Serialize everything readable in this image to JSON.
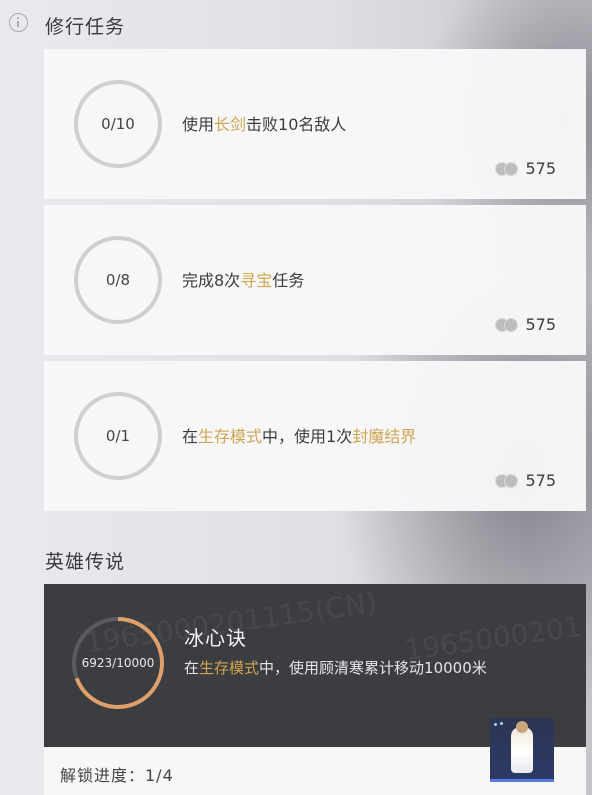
{
  "header": {
    "title": "修行任务"
  },
  "tasks": [
    {
      "progress": "0/10",
      "parts": [
        "使用",
        "长剑",
        "击败10名敌人"
      ],
      "reward": "575"
    },
    {
      "progress": "0/8",
      "parts": [
        "完成8次",
        "寻宝",
        "任务"
      ],
      "reward": "575"
    },
    {
      "progress": "0/1",
      "parts": [
        "在",
        "生存模式",
        "中，使用1次",
        "封魔结界"
      ],
      "reward": "575"
    }
  ],
  "legend": {
    "section_title": "英雄传说",
    "progress": "6923/10000",
    "progress_fraction": 0.6923,
    "name": "冰心诀",
    "desc_parts": [
      "在",
      "生存模式",
      "中，使用顾清寒累计移动10000米"
    ],
    "unlock": "解锁进度：1/4"
  },
  "colors": {
    "highlight": "#d0a552",
    "ring_progress": "#e0a06a",
    "ring_track": "#5a5b60"
  }
}
